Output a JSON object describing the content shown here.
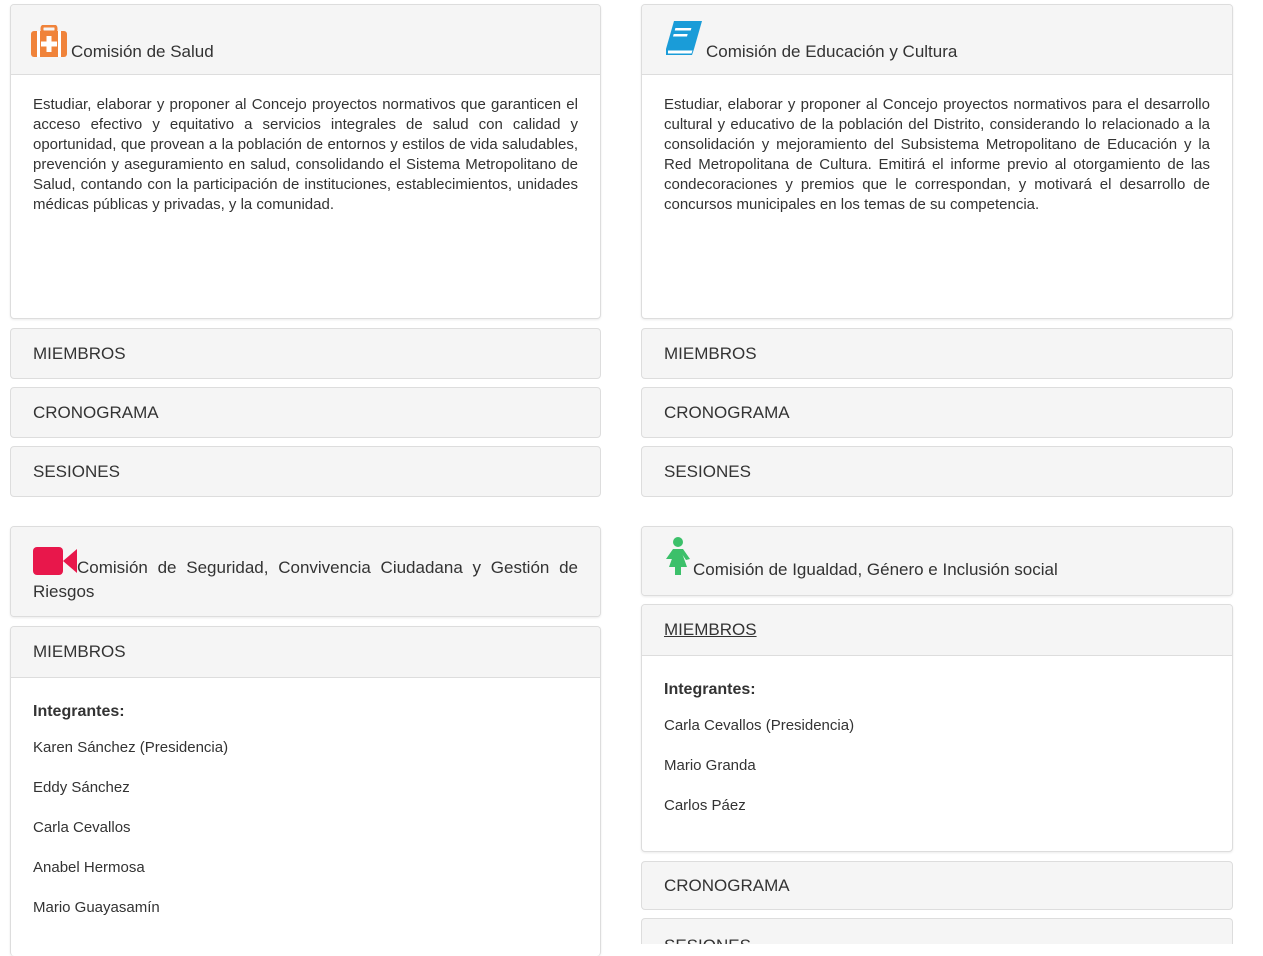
{
  "commissions": [
    {
      "title": "Comisión de Salud",
      "icon": "first-aid-kit-icon",
      "icon_color": "#f0833a",
      "description": "Estudiar, elaborar y proponer al Concejo proyectos normativos que garanticen el acceso efectivo y equitativo a servicios integrales de salud con calidad y oportunidad, que provean a la población de entornos y estilos de vida saludables, prevención y aseguramiento en salud, consolidando el Sistema Metropolitano de Salud, contando con la participación de instituciones, establecimientos, unidades médicas públicas y privadas, y la comunidad.",
      "sections": [
        "MIEMBROS",
        "CRONOGRAMA",
        "SESIONES"
      ]
    },
    {
      "title": "Comisión de Educación y Cultura",
      "icon": "book-icon",
      "icon_color": "#1a9cd8",
      "description": "Estudiar, elaborar y proponer al Concejo proyectos normativos para el desarrollo cultural y educativo de la población del Distrito, considerando lo relacionado a la consolidación y mejoramiento del Subsistema Metropolitano de Educación y la Red Metropolitana de Cultura. Emitirá el informe previo al otorgamiento de las condecoraciones y premios que le correspondan, y motivará el desarrollo de concursos municipales en los temas de su competencia.",
      "sections": [
        "MIEMBROS",
        "CRONOGRAMA",
        "SESIONES"
      ]
    },
    {
      "title": "Comisión de Seguridad, Convivencia Ciudadana y Gestión de Riesgos",
      "icon": "video-camera-icon",
      "icon_color": "#e8174b",
      "members_label": "MIEMBROS",
      "integrantes_label": "Integrantes:",
      "members": [
        "Karen Sánchez (Presidencia)",
        "Eddy Sánchez",
        "Carla Cevallos",
        "Anabel Hermosa",
        "Mario Guayasamín"
      ]
    },
    {
      "title": "Comisión de Igualdad, Género e Inclusión social",
      "icon": "person-icon",
      "icon_color": "#3cc06a",
      "members_label": "MIEMBROS",
      "integrantes_label": "Integrantes:",
      "members": [
        "Carla Cevallos (Presidencia)",
        "Mario Granda",
        "Carlos Páez"
      ],
      "sections": [
        "CRONOGRAMA",
        "SESIONES"
      ]
    }
  ]
}
